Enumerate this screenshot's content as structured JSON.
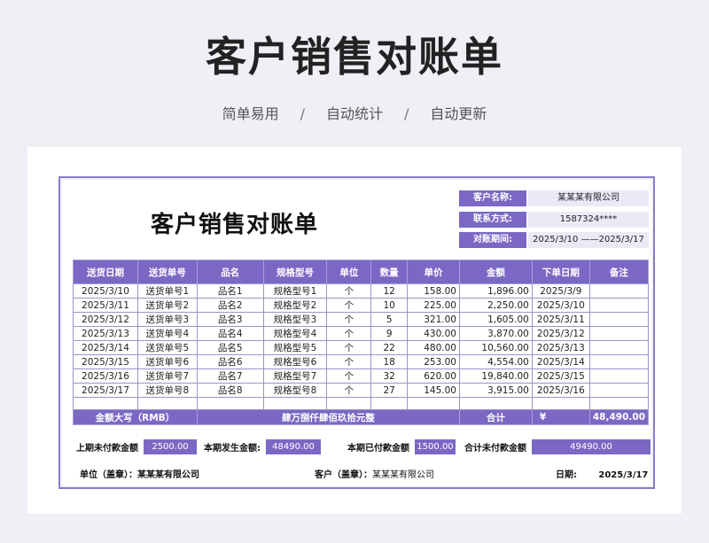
{
  "header": {
    "title": "客户销售对账单",
    "tags": [
      "简单易用",
      "自动统计",
      "自动更新"
    ],
    "separator": "/"
  },
  "doc": {
    "title": "客户销售对账单",
    "info": [
      {
        "label": "客户名称:",
        "value": "某某某有限公司"
      },
      {
        "label": "联系方式:",
        "value": "1587324****"
      },
      {
        "label": "对账期间:",
        "value": "2025/3/10 ——2025/3/17"
      }
    ],
    "columns": [
      "送货日期",
      "送货单号",
      "品名",
      "规格型号",
      "单位",
      "数量",
      "单价",
      "金额",
      "下单日期",
      "备注"
    ],
    "rows": [
      [
        "2025/3/10",
        "送货单号1",
        "品名1",
        "规格型号1",
        "个",
        "12",
        "158.00",
        "1,896.00",
        "2025/3/9",
        ""
      ],
      [
        "2025/3/11",
        "送货单号2",
        "品名2",
        "规格型号2",
        "个",
        "10",
        "225.00",
        "2,250.00",
        "2025/3/10",
        ""
      ],
      [
        "2025/3/12",
        "送货单号3",
        "品名3",
        "规格型号3",
        "个",
        "5",
        "321.00",
        "1,605.00",
        "2025/3/11",
        ""
      ],
      [
        "2025/3/13",
        "送货单号4",
        "品名4",
        "规格型号4",
        "个",
        "9",
        "430.00",
        "3,870.00",
        "2025/3/12",
        ""
      ],
      [
        "2025/3/14",
        "送货单号5",
        "品名5",
        "规格型号5",
        "个",
        "22",
        "480.00",
        "10,560.00",
        "2025/3/13",
        ""
      ],
      [
        "2025/3/15",
        "送货单号6",
        "品名6",
        "规格型号6",
        "个",
        "18",
        "253.00",
        "4,554.00",
        "2025/3/14",
        ""
      ],
      [
        "2025/3/16",
        "送货单号7",
        "品名7",
        "规格型号7",
        "个",
        "32",
        "620.00",
        "19,840.00",
        "2025/3/15",
        ""
      ],
      [
        "2025/3/17",
        "送货单号8",
        "品名8",
        "规格型号8",
        "个",
        "27",
        "145.00",
        "3,915.00",
        "2025/3/16",
        ""
      ]
    ],
    "summary": {
      "upper_label": "金额大写（RMB）",
      "upper_value": "肆万捌仟肆佰玖拾元整",
      "total_label": "合计",
      "currency": "¥",
      "total_value": "48,490.00"
    },
    "totals": {
      "prev_unpaid_label": "上期未付款金额",
      "prev_unpaid_value": "2500.00",
      "period_amount_label": "本期发生金额:",
      "period_amount_value": "48490.00",
      "period_paid_label": "本期已付款金额",
      "period_paid_value": "1500.00",
      "total_unpaid_label": "合计未付款金额",
      "total_unpaid_value": "49490.00"
    },
    "footer": {
      "unit_label": "单位（盖章）：",
      "unit_value": "某某某有限公司",
      "customer_label": "客户（盖章）：",
      "customer_value": "某某某有限公司",
      "date_label": "日期:",
      "date_value": "2025/3/17"
    }
  }
}
